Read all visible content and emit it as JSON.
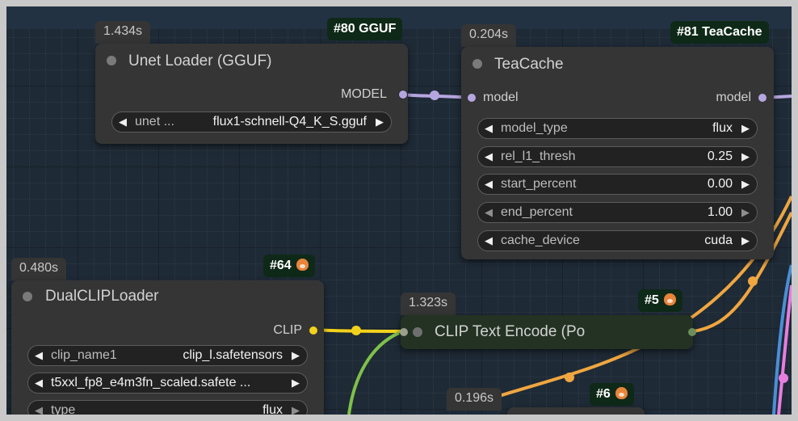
{
  "nodes": {
    "unet_loader": {
      "timer": "1.434s",
      "badge": "#80 GGUF",
      "title": "Unet Loader (GGUF)",
      "output_label": "MODEL",
      "widget": {
        "label": "unet ...",
        "value": "flux1-schnell-Q4_K_S.gguf"
      }
    },
    "teacache": {
      "timer": "0.204s",
      "badge": "#81 TeaCache",
      "title": "TeaCache",
      "input_label": "model",
      "output_label": "model",
      "widgets": [
        {
          "label": "model_type",
          "value": "flux"
        },
        {
          "label": "rel_l1_thresh",
          "value": "0.25"
        },
        {
          "label": "start_percent",
          "value": "0.00"
        },
        {
          "label": "end_percent",
          "value": "1.00"
        },
        {
          "label": "cache_device",
          "value": "cuda"
        }
      ]
    },
    "dual_clip_loader": {
      "timer": "0.480s",
      "badge": "#64",
      "title": "DualCLIPLoader",
      "output_label": "CLIP",
      "widgets": [
        {
          "label": "clip_name1",
          "value": "clip_l.safetensors"
        },
        {
          "label": "",
          "value": "t5xxl_fp8_e4m3fn_scaled.safete ..."
        },
        {
          "label": "type",
          "value": "flux"
        }
      ]
    },
    "clip_text_encode": {
      "timer": "1.323s",
      "badge": "#5",
      "title": "CLIP Text Encode (Po"
    },
    "node6": {
      "timer": "0.196s",
      "badge": "#6"
    }
  },
  "icons": {
    "arrow_left": "◀",
    "arrow_right": "▶",
    "badge_icon": "fox-emoji-icon"
  },
  "colors": {
    "canvas": "#1e2a36",
    "node_bg": "#353535",
    "wire_model": "#b6a6e0",
    "wire_clip": "#f2d11c",
    "wire_conditioning": "#f0a640",
    "wire_green": "#7fc04a",
    "wire_blue": "#4a8fd8",
    "wire_pink": "#e87de0"
  }
}
